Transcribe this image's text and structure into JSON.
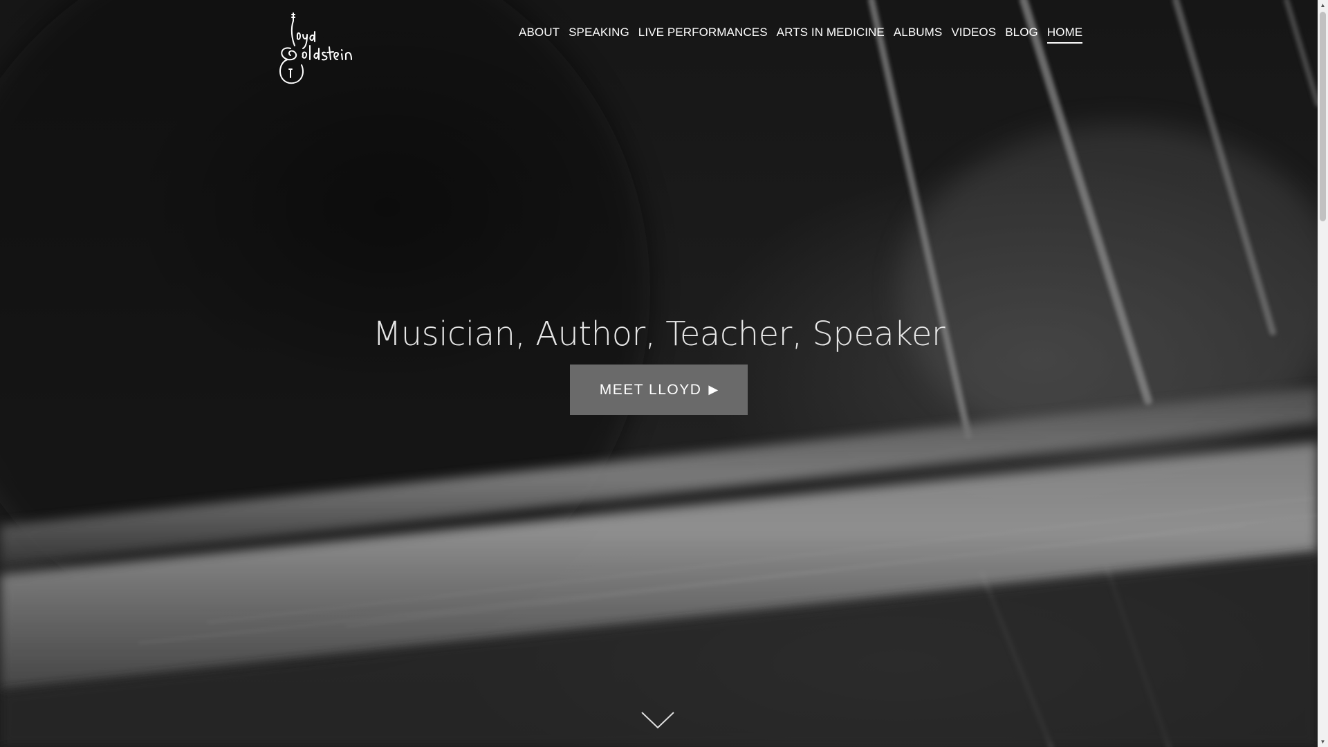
{
  "header": {
    "logo_text": "lloyd Goldstein",
    "nav": [
      {
        "label": "ABOUT"
      },
      {
        "label": "SPEAKING"
      },
      {
        "label": "LIVE PERFORMANCES"
      },
      {
        "label": "ARTS IN MEDICINE"
      },
      {
        "label": "ALBUMS"
      },
      {
        "label": "VIDEOS"
      },
      {
        "label": "BLOG"
      },
      {
        "label": "HOME",
        "active": true
      }
    ]
  },
  "hero": {
    "tagline": "Musician, Author, Teacher, Speaker",
    "cta_label": "MEET LLOYD",
    "cta_icon": "play-triangle-icon",
    "scroll_icon": "chevron-down-icon"
  },
  "colors": {
    "background": "#151515",
    "text": "#ffffff",
    "button": "#6a6a6a"
  }
}
